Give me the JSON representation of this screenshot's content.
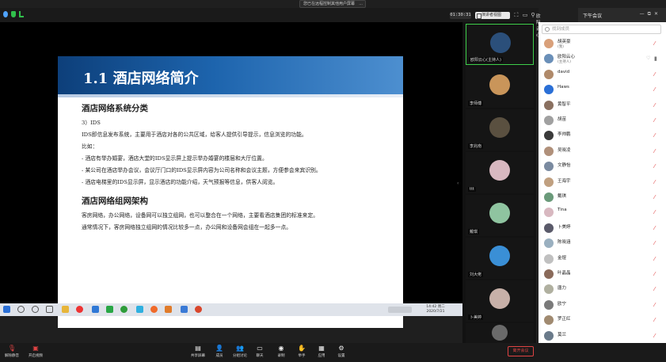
{
  "share_banner": {
    "text": "您已在远程控制其他用户屏幕",
    "more": "..."
  },
  "topbar": {
    "timer": "01:30:31",
    "view_label": "演讲者视图",
    "host": "欧阳云心"
  },
  "panel": {
    "title": "下午会议",
    "ctrl_min": "—",
    "ctrl_pop": "⧉",
    "ctrl_close": "✕"
  },
  "slide": {
    "title": "1.1  酒店网络简介",
    "section1": {
      "heading": "酒店网络系统分类",
      "lines": [
        "3）IDS",
        "IDS即信息发布系统，主要用于酒店对各的公共区域，给客人提供引导提示，信息浏览的功能。",
        "比如："
      ],
      "bullets": [
        "-     酒店有举办婚宴，酒店大堂的IDS显示屏上提示举办婚宴的楼层和大厅位置。",
        "-     某公司在酒店举办会议，会议厅门口的IDS显示屏内容为公司名称和会议主题，方便参会来宾识别。",
        "-     酒店电梯里的IDS显示屏，显示酒店的功能介绍，天气预报等信息，供客人阅览。"
      ]
    },
    "section2": {
      "heading": "酒店网络组网架构",
      "lines": [
        "客房网络，办公网络，设备网可以独立组网，也可以整合在一个网络，主要看酒店集团的标准来定。",
        "通常情况下，客房网络独立组网的情况比较多一点，办公网和设备网会组在一起多一点。"
      ]
    }
  },
  "taskbar": {
    "time_line1": "14:42 周二",
    "time_line2": "2020/7/21"
  },
  "video_tiles": [
    {
      "name": "欧阳云心(主持人)"
    },
    {
      "name": "李师傅"
    },
    {
      "name": "李兆南"
    },
    {
      "name": "ttt"
    },
    {
      "name": "戴琪"
    },
    {
      "name": "刘大佬"
    },
    {
      "name": "卜美婷"
    },
    {
      "name": ""
    }
  ],
  "participants": {
    "search_placeholder": "找到成员",
    "rows": [
      {
        "name": "胡英豪",
        "role": "(我)",
        "mic": "muted"
      },
      {
        "name": "欧阳云心",
        "role": "(主持人)",
        "mic": "live"
      },
      {
        "name": "david",
        "role": "",
        "mic": "muted"
      },
      {
        "name": "Haws",
        "role": "",
        "mic": "muted"
      },
      {
        "name": "黄智平",
        "role": "",
        "mic": "muted"
      },
      {
        "name": "胡苗",
        "role": "",
        "mic": "muted"
      },
      {
        "name": "李帅鹏",
        "role": "",
        "mic": "muted"
      },
      {
        "name": "吴晓凌",
        "role": "",
        "mic": "muted"
      },
      {
        "name": "文静怡",
        "role": "",
        "mic": "muted"
      },
      {
        "name": "王海宇",
        "role": "",
        "mic": "muted"
      },
      {
        "name": "戴琪",
        "role": "",
        "mic": "muted"
      },
      {
        "name": "Tina",
        "role": "",
        "mic": "muted"
      },
      {
        "name": "卜美婷",
        "role": "",
        "mic": "muted"
      },
      {
        "name": "陈晓涵",
        "role": "",
        "mic": "muted"
      },
      {
        "name": "金煜",
        "role": "",
        "mic": "muted"
      },
      {
        "name": "叶晶晶",
        "role": "",
        "mic": "muted"
      },
      {
        "name": "唐力",
        "role": "",
        "mic": "muted"
      },
      {
        "name": "欧宁",
        "role": "",
        "mic": "muted"
      },
      {
        "name": "罗正红",
        "role": "",
        "mic": "muted"
      },
      {
        "name": "莫兰",
        "role": "",
        "mic": "muted"
      }
    ]
  },
  "bottombar": {
    "unmute": "解除静音",
    "video": "开启视频",
    "share": "共享屏幕",
    "participants": "成员",
    "chat_room": "分组讨论",
    "chat": "聊天",
    "record": "录制",
    "reactions": "举手",
    "apps": "应用",
    "settings": "设置",
    "leave": "离开会议"
  },
  "colors": {
    "slide_blue": "#1d64ad",
    "accent_green": "#3ecf4a",
    "mute_red": "#e04343"
  }
}
